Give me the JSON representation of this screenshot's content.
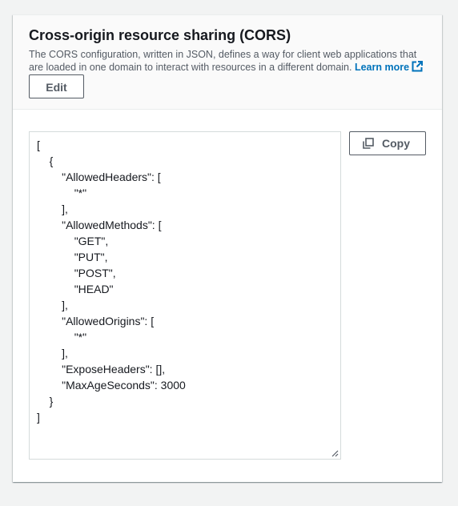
{
  "cors_section": {
    "title": "Cross-origin resource sharing (CORS)",
    "description": "The CORS configuration, written in JSON, defines a way for client web applications that are loaded in one domain to interact with resources in a different domain.",
    "learn_more_label": "Learn more",
    "learn_more_icon": "external-link-icon",
    "edit_label": "Edit",
    "copy_label": "Copy",
    "copy_icon": "copy-icon",
    "configuration_json": "[\n\t{\n\t\t\"AllowedHeaders\": [\n\t\t\t\"*\"\n\t\t],\n\t\t\"AllowedMethods\": [\n\t\t\t\"GET\",\n\t\t\t\"PUT\",\n\t\t\t\"POST\",\n\t\t\t\"HEAD\"\n\t\t],\n\t\t\"AllowedOrigins\": [\n\t\t\t\"*\"\n\t\t],\n\t\t\"ExposeHeaders\": [],\n\t\t\"MaxAgeSeconds\": 3000\n\t}\n]"
  },
  "colors": {
    "link": "#0073bb",
    "button_border": "#545b64",
    "header_bg": "#fafafa",
    "page_bg": "#f2f3f3"
  }
}
